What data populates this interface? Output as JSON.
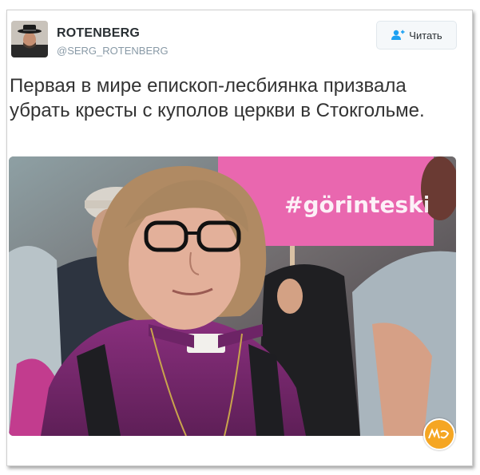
{
  "tweet": {
    "display_name": "ROTENBERG",
    "handle": "@SERG_ROTENBERG",
    "follow_label": "Читать",
    "text": "Первая в мире епископ-лесбиянка призвала убрать кресты с куполов церкви в Стокгольме."
  },
  "photo": {
    "banner_text": "#görinteskill"
  },
  "colors": {
    "accent": "#1da1f2",
    "banner_pink": "#e35fa8",
    "clergy_purple": "#7a2d73"
  },
  "icons": {
    "follow": "add-user-icon",
    "watermark": "site-logo"
  }
}
